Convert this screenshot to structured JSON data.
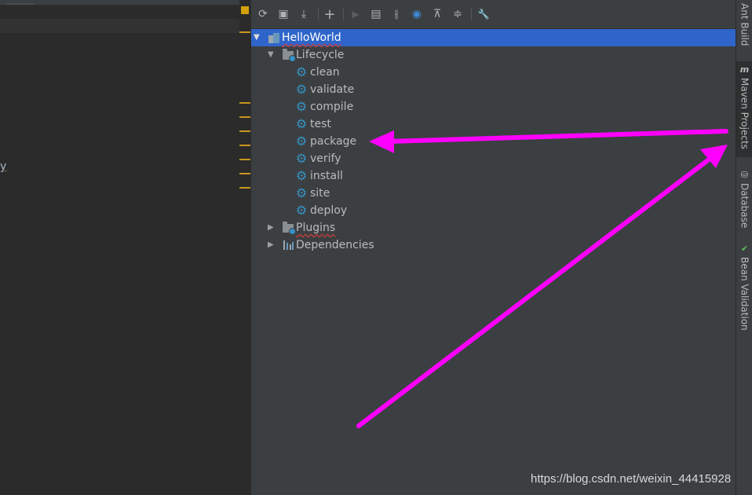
{
  "editor": {
    "code_fragment": "y"
  },
  "toolbar": {
    "buttons": [
      {
        "icon": "refresh-icon",
        "glyph": "⟳"
      },
      {
        "icon": "generate-sources-icon",
        "glyph": "▣"
      },
      {
        "icon": "download-icon",
        "glyph": "⤓"
      },
      {
        "icon": "add-icon",
        "glyph": "+"
      },
      {
        "icon": "run-icon",
        "glyph": "▶"
      },
      {
        "icon": "execute-goal-icon",
        "glyph": "▤"
      },
      {
        "icon": "toggle-offline-icon",
        "glyph": "⫲"
      },
      {
        "icon": "skip-tests-icon",
        "glyph": "◉"
      },
      {
        "icon": "expand-all-icon",
        "glyph": "⊼"
      },
      {
        "icon": "collapse-all-icon",
        "glyph": "≑"
      },
      {
        "icon": "settings-wrench-icon",
        "glyph": "🔧"
      }
    ]
  },
  "tree": {
    "project": "HelloWorld",
    "lifecycle": {
      "label": "Lifecycle",
      "phases": [
        "clean",
        "validate",
        "compile",
        "test",
        "package",
        "verify",
        "install",
        "site",
        "deploy"
      ]
    },
    "plugins": "Plugins",
    "dependencies": "Dependencies"
  },
  "right_tabs": {
    "ant": "Ant Build",
    "maven_icon": "m",
    "maven": "Maven Projects",
    "database": "Database",
    "bean": "Bean Validation"
  },
  "colors": {
    "selection": "#2f65ca",
    "annotation_arrow": "#ff00ff",
    "gear": "#3592c4",
    "panel_bg": "#3c3f41"
  },
  "watermark": "https://blog.csdn.net/weixin_44415928"
}
